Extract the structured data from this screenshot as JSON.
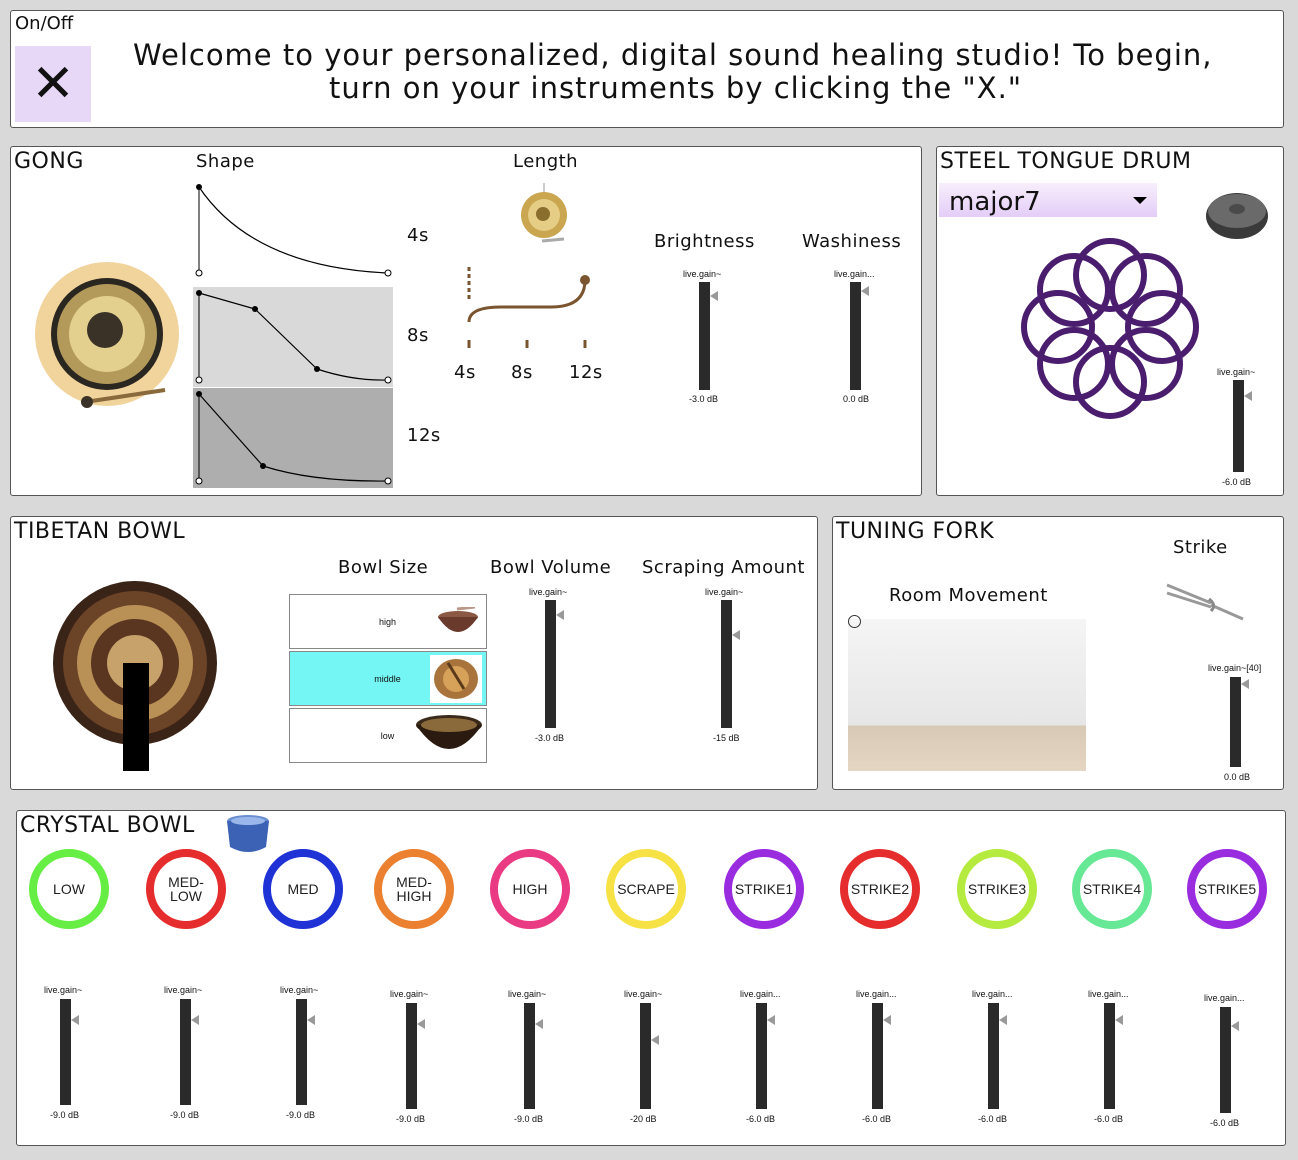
{
  "header": {
    "onoff_label": "On/Off",
    "onoff_symbol": "✕",
    "welcome_line1": "Welcome to your personalized, digital sound healing studio! To  begin,",
    "welcome_line2": "turn on your instruments by clicking the \"X.\""
  },
  "gong": {
    "title": "GONG",
    "shape_label": "Shape",
    "length_label": "Length",
    "durations": [
      "4s",
      "8s",
      "12s"
    ],
    "length_ticks": [
      "4s",
      "8s",
      "12s"
    ],
    "brightness_label": "Brightness",
    "washiness_label": "Washiness",
    "brightness_slider": {
      "name": "live.gain~",
      "value": "-3.0 dB"
    },
    "washiness_slider": {
      "name": "live.gain...",
      "value": "0.0 dB"
    }
  },
  "steel_drum": {
    "title": "STEEL TONGUE DRUM",
    "scale_selected": "major7",
    "slider": {
      "name": "live.gain~",
      "value": "-6.0 dB"
    }
  },
  "tibetan_bowl": {
    "title": "TIBETAN BOWL",
    "size_label": "Bowl Size",
    "volume_label": "Bowl Volume",
    "scraping_label": "Scraping Amount",
    "sizes": [
      "high",
      "middle",
      "low"
    ],
    "selected_size": "middle",
    "volume_slider": {
      "name": "live.gain~",
      "value": "-3.0 dB"
    },
    "scraping_slider": {
      "name": "live.gain~",
      "value": "-15 dB"
    }
  },
  "tuning_fork": {
    "title": "TUNING FORK",
    "strike_label": "Strike",
    "room_label": "Room Movement",
    "slider": {
      "name": "live.gain~[40]",
      "value": "0.0 dB"
    }
  },
  "crystal_bowl": {
    "title": "CRYSTAL BOWL",
    "buttons": [
      {
        "label": "LOW",
        "color": "#66ee44"
      },
      {
        "label": "MED-\nLOW",
        "color": "#e62d2d"
      },
      {
        "label": "MED",
        "color": "#1f32d6"
      },
      {
        "label": "MED-\nHIGH",
        "color": "#ea8030"
      },
      {
        "label": "HIGH",
        "color": "#ea3a84"
      },
      {
        "label": "SCRAPE",
        "color": "#f7e245"
      },
      {
        "label": "STRIKE1",
        "color": "#9a2ce0"
      },
      {
        "label": "STRIKE2",
        "color": "#e62d2d"
      },
      {
        "label": "STRIKE3",
        "color": "#b5ea3e"
      },
      {
        "label": "STRIKE4",
        "color": "#66e894"
      },
      {
        "label": "STRIKE5",
        "color": "#9a2ce0"
      }
    ],
    "sliders": [
      {
        "name": "live.gain~",
        "value": "-9.0 dB"
      },
      {
        "name": "live.gain~",
        "value": "-9.0 dB"
      },
      {
        "name": "live.gain~",
        "value": "-9.0 dB"
      },
      {
        "name": "live.gain~",
        "value": "-9.0 dB"
      },
      {
        "name": "live.gain~",
        "value": "-9.0 dB"
      },
      {
        "name": "live.gain~",
        "value": "-20 dB"
      },
      {
        "name": "live.gain...",
        "value": "-6.0 dB"
      },
      {
        "name": "live.gain...",
        "value": "-6.0 dB"
      },
      {
        "name": "live.gain...",
        "value": "-6.0 dB"
      },
      {
        "name": "live.gain...",
        "value": "-6.0 dB"
      },
      {
        "name": "live.gain...",
        "value": "-6.0 dB"
      }
    ]
  }
}
